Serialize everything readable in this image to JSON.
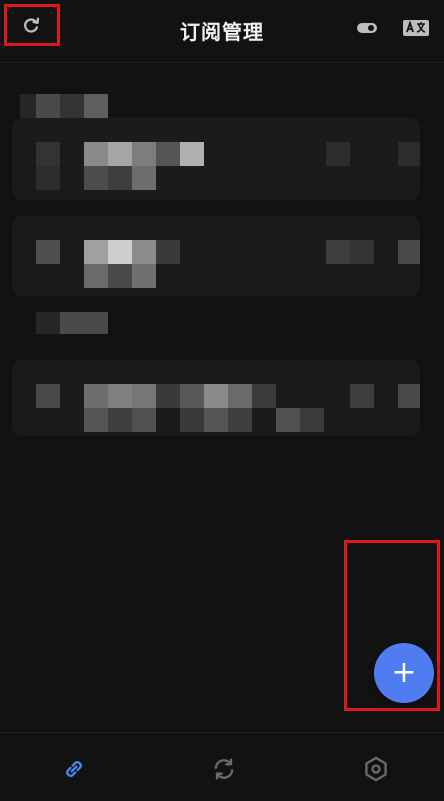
{
  "header": {
    "title": "订阅管理",
    "icons": [
      "refresh-icon",
      "toggle-icon",
      "translate-icon"
    ]
  },
  "fab": {
    "label": "+",
    "color": "#4f7cf0"
  },
  "bottom_nav": {
    "items": [
      {
        "icon": "link-icon",
        "active": true,
        "color": "#4a86f0"
      },
      {
        "icon": "sync-icon",
        "active": false,
        "color": "#6a6a6a"
      },
      {
        "icon": "settings-icon",
        "active": false,
        "color": "#6a6a6a"
      }
    ]
  },
  "colors": {
    "background": "#121212",
    "highlight": "#e01818"
  }
}
